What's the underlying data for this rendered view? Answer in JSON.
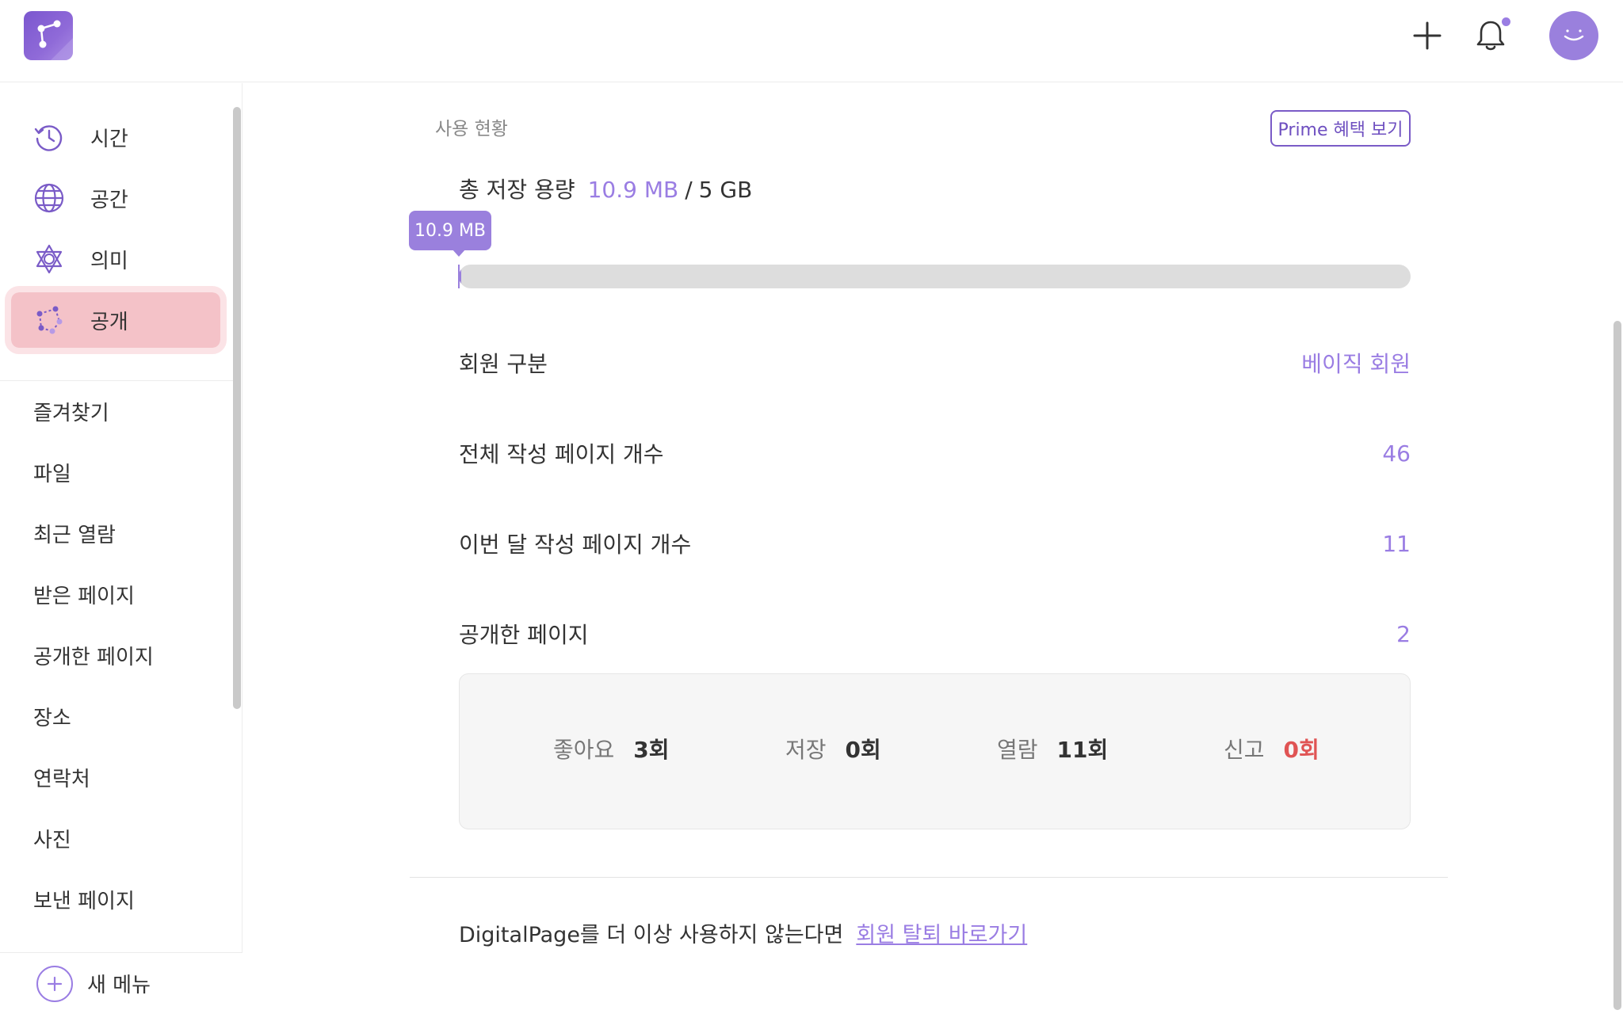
{
  "colors": {
    "accent": "#9a80dd",
    "accent_text": "#9a7de3",
    "active_bg": "#f4c2c8",
    "danger": "#e05454"
  },
  "header": {
    "logo_icon": "share-nodes-icon",
    "add_icon": "plus-icon",
    "notification_icon": "bell-icon",
    "avatar_icon": "smile-icon"
  },
  "sidebar": {
    "nav": [
      {
        "label": "시간",
        "icon": "clock-history-icon"
      },
      {
        "label": "공간",
        "icon": "globe-icon"
      },
      {
        "label": "의미",
        "icon": "hexagram-icon"
      },
      {
        "label": "공개",
        "icon": "share-nodes-icon"
      }
    ],
    "active_nav": "공개",
    "menu": [
      "즐겨찾기",
      "파일",
      "최근 열람",
      "받은 페이지",
      "공개한 페이지",
      "장소",
      "연락처",
      "사진",
      "보낸 페이지"
    ],
    "new_menu_label": "새 메뉴"
  },
  "usage": {
    "section_title": "사용 현황",
    "prime_button": "Prime 혜택 보기",
    "storage": {
      "label": "총 저장 용량",
      "used": "10.9 MB",
      "separator": "/",
      "total": "5 GB",
      "tooltip": "10.9 MB",
      "fraction": 0.0021
    },
    "rows": [
      {
        "label": "회원 구분",
        "value": "베이직 회원"
      },
      {
        "label": "전체 작성 페이지 개수",
        "value": "46"
      },
      {
        "label": "이번 달 작성 페이지 개수",
        "value": "11"
      },
      {
        "label": "공개한 페이지",
        "value": "2"
      }
    ],
    "reactions": [
      {
        "label": "좋아요",
        "value": "3회"
      },
      {
        "label": "저장",
        "value": "0회"
      },
      {
        "label": "열람",
        "value": "11회"
      },
      {
        "label": "신고",
        "value": "0회"
      }
    ]
  },
  "footer": {
    "text": "DigitalPage를 더 이상 사용하지 않는다면",
    "link": "회원 탈퇴 바로가기"
  }
}
